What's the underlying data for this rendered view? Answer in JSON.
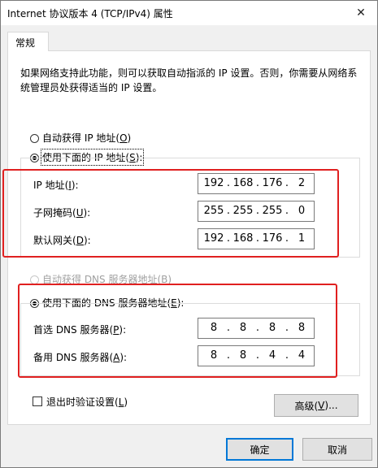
{
  "window": {
    "title": "Internet 协议版本 4 (TCP/IPv4) 属性",
    "close_symbol": "✕"
  },
  "tab": {
    "label": "常规"
  },
  "description": "如果网络支持此功能，则可以获取自动指派的 IP 设置。否则，你需要从网络系统管理员处获得适当的 IP 设置。",
  "ip": {
    "auto_label": "自动获得 IP 地址(",
    "auto_key": "O",
    "manual_label": "使用下面的 IP 地址(",
    "manual_key": "S",
    "address_label": "IP 地址(",
    "address_key": "I",
    "address": [
      "192",
      "168",
      "176",
      "2"
    ],
    "mask_label": "子网掩码(",
    "mask_key": "U",
    "mask": [
      "255",
      "255",
      "255",
      "0"
    ],
    "gateway_label": "默认网关(",
    "gateway_key": "D",
    "gateway": [
      "192",
      "168",
      "176",
      "1"
    ]
  },
  "dns": {
    "auto_label": "自动获得 DNS 服务器地址(",
    "auto_key": "B",
    "manual_label": "使用下面的 DNS 服务器地址(",
    "manual_key": "E",
    "preferred_label": "首选 DNS 服务器(",
    "preferred_key": "P",
    "preferred": [
      "8",
      "8",
      "8",
      "8"
    ],
    "alternate_label": "备用 DNS 服务器(",
    "alternate_key": "A",
    "alternate": [
      "8",
      "8",
      "4",
      "4"
    ]
  },
  "validate": {
    "label": "退出时验证设置(",
    "key": "L"
  },
  "buttons": {
    "advanced_label": "高级(",
    "advanced_key": "V",
    "advanced_suffix": ")...",
    "ok": "确定",
    "cancel": "取消"
  },
  "colors": {
    "highlight": "#e02020",
    "default_button_border": "#0078d7"
  }
}
